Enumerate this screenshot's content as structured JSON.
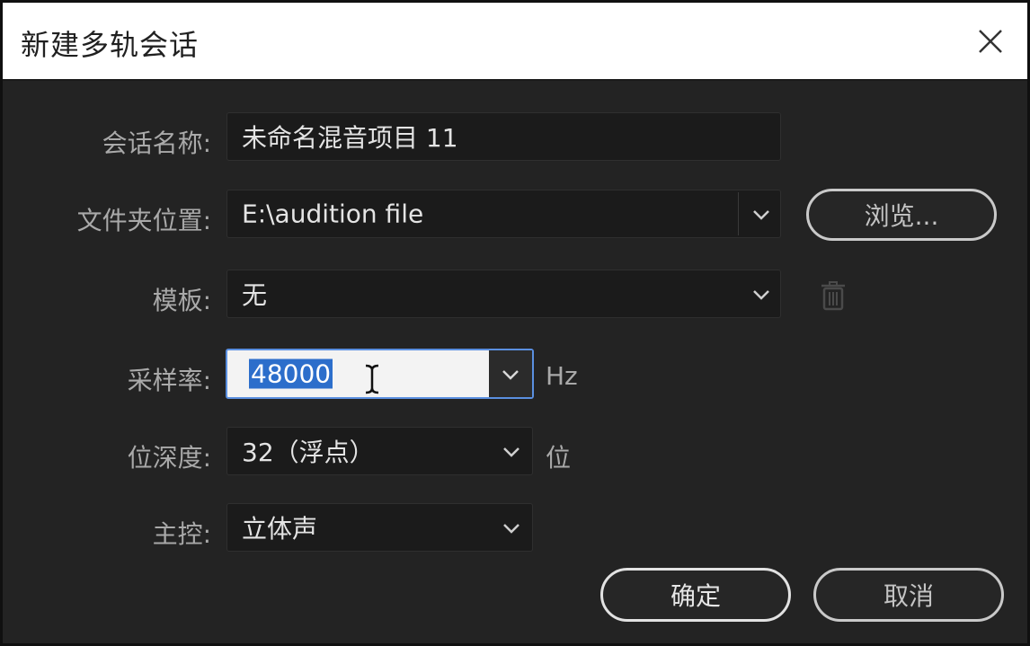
{
  "dialog": {
    "title": "新建多轨会话",
    "close_icon": "close-icon"
  },
  "form": {
    "session_name": {
      "label": "会话名称:",
      "value": "未命名混音项目 11"
    },
    "folder_location": {
      "label": "文件夹位置:",
      "value": "E:\\audition file",
      "browse_label": "浏览..."
    },
    "template": {
      "label": "模板:",
      "value": "无",
      "delete_icon": "trash-icon"
    },
    "sample_rate": {
      "label": "采样率:",
      "value": "48000",
      "unit": "Hz"
    },
    "bit_depth": {
      "label": "位深度:",
      "value": "32（浮点）",
      "unit": "位"
    },
    "master": {
      "label": "主控:",
      "value": "立体声"
    }
  },
  "buttons": {
    "ok": "确定",
    "cancel": "取消"
  },
  "colors": {
    "dialog_bg": "#232323",
    "field_bg": "#1b1b1b",
    "focus_border": "#5a8fe0",
    "selection": "#2c6ecb"
  }
}
